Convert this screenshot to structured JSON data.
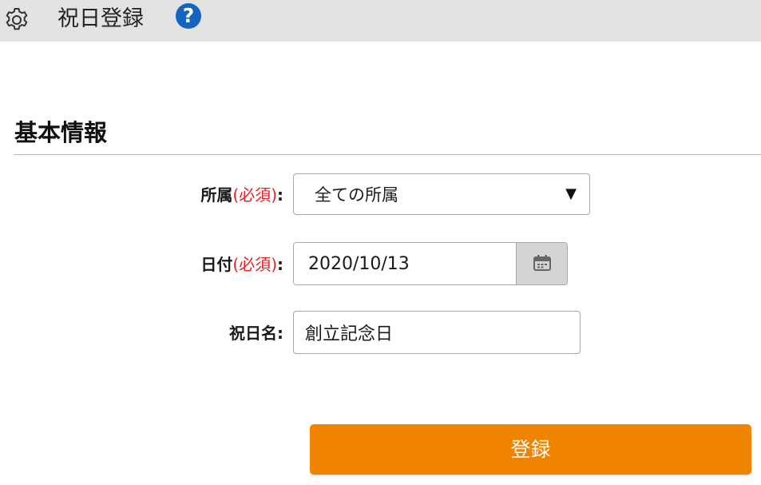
{
  "header": {
    "title": "祝日登録",
    "help_glyph": "?",
    "icons": {
      "settings": "gear-icon",
      "help": "help-circle-icon"
    }
  },
  "section": {
    "title": "基本情報"
  },
  "form": {
    "affiliation": {
      "label": "所属",
      "required": "(必須)",
      "colon": ":",
      "value": "全ての所属",
      "arrow": "▼"
    },
    "date": {
      "label": "日付",
      "required": "(必須)",
      "colon": ":",
      "value": "2020/10/13",
      "icon": "calendar-icon"
    },
    "holiday_name": {
      "label": "祝日名",
      "colon": ":",
      "value": "創立記念日"
    },
    "submit_label": "登録"
  },
  "colors": {
    "header_bg": "#e3e3e3",
    "help": "#1565c0",
    "required": "#e8202a",
    "submit": "#f08300"
  }
}
